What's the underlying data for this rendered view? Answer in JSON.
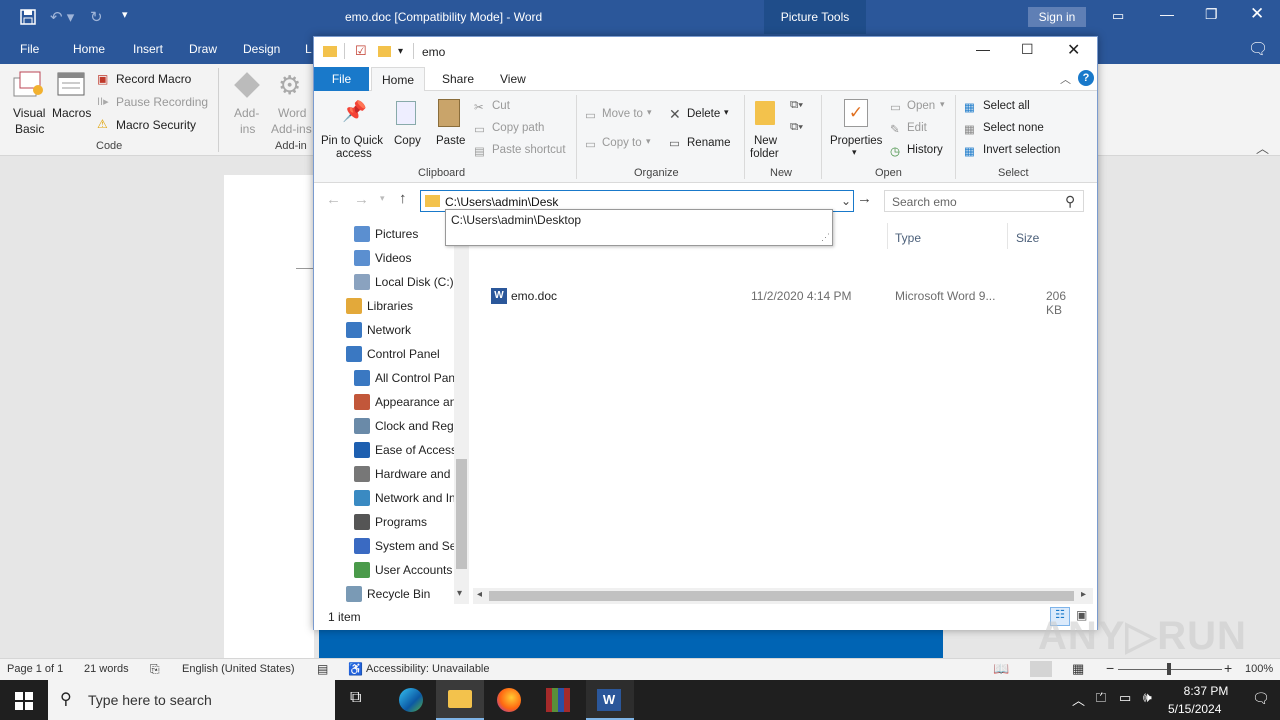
{
  "word": {
    "title": "emo.doc [Compatibility Mode]  -  Word",
    "picture_tools": "Picture Tools",
    "sign_in": "Sign in",
    "tabs": [
      "File",
      "Home",
      "Insert",
      "Draw",
      "Design",
      "L"
    ],
    "ribbon": {
      "visual_basic_1": "Visual",
      "visual_basic_2": "Basic",
      "macros": "Macros",
      "record_macro": "Record Macro",
      "pause_recording": "Pause Recording",
      "macro_security": "Macro Security",
      "code_group": "Code",
      "addins_1": "Add-",
      "addins_2": "ins",
      "word_addins_1": "Word",
      "word_addins_2": "Add-ins",
      "addins_group": "Add-in"
    },
    "status": {
      "page": "Page 1 of 1",
      "words": "21 words",
      "language": "English (United States)",
      "accessibility": "Accessibility: Unavailable",
      "zoom": "100%"
    }
  },
  "explorer": {
    "title": "emo",
    "tabs": [
      "File",
      "Home",
      "Share",
      "View"
    ],
    "clipboard": {
      "pin_1": "Pin to Quick",
      "pin_2": "access",
      "copy": "Copy",
      "paste": "Paste",
      "cut": "Cut",
      "copy_path": "Copy path",
      "paste_shortcut": "Paste shortcut",
      "label": "Clipboard"
    },
    "organize": {
      "move_to": "Move to",
      "copy_to": "Copy to",
      "delete": "Delete",
      "rename": "Rename",
      "label": "Organize"
    },
    "new": {
      "new_folder_1": "New",
      "new_folder_2": "folder",
      "label": "New"
    },
    "open": {
      "properties": "Properties",
      "open": "Open",
      "edit": "Edit",
      "history": "History",
      "label": "Open"
    },
    "select": {
      "select_all": "Select all",
      "select_none": "Select none",
      "invert": "Invert selection",
      "label": "Select"
    },
    "address": {
      "value": "C:\\Users\\admin\\Desk",
      "suggestion": "C:\\Users\\admin\\Desktop",
      "search_placeholder": "Search emo"
    },
    "nav": [
      {
        "label": "Pictures",
        "icon": "pictures-icon",
        "indent": 1
      },
      {
        "label": "Videos",
        "icon": "videos-icon",
        "indent": 1
      },
      {
        "label": "Local Disk (C:)",
        "icon": "disk-icon",
        "indent": 1
      },
      {
        "label": "Libraries",
        "icon": "libraries-icon",
        "indent": 0
      },
      {
        "label": "Network",
        "icon": "network-icon",
        "indent": 0
      },
      {
        "label": "Control Panel",
        "icon": "control-panel-icon",
        "indent": 0
      },
      {
        "label": "All Control Panel Items",
        "icon": "control-panel-icon",
        "indent": 1
      },
      {
        "label": "Appearance and Personalization",
        "icon": "appearance-icon",
        "indent": 1
      },
      {
        "label": "Clock and Region",
        "icon": "clock-icon",
        "indent": 1
      },
      {
        "label": "Ease of Access",
        "icon": "ease-of-access-icon",
        "indent": 1
      },
      {
        "label": "Hardware and Sound",
        "icon": "hardware-icon",
        "indent": 1
      },
      {
        "label": "Network and Internet",
        "icon": "network-internet-icon",
        "indent": 1
      },
      {
        "label": "Programs",
        "icon": "programs-icon",
        "indent": 1
      },
      {
        "label": "System and Security",
        "icon": "system-security-icon",
        "indent": 1
      },
      {
        "label": "User Accounts",
        "icon": "user-accounts-icon",
        "indent": 1
      },
      {
        "label": "Recycle Bin",
        "icon": "recycle-bin-icon",
        "indent": 0
      }
    ],
    "columns": {
      "type": "Type",
      "size": "Size"
    },
    "files": [
      {
        "name": "emo.doc",
        "date": "11/2/2020 4:14 PM",
        "type": "Microsoft Word 9...",
        "size": "206 KB"
      }
    ],
    "status": "1 item"
  },
  "taskbar": {
    "search_placeholder": "Type here to search",
    "time": "8:37 PM",
    "date": "5/15/2024"
  },
  "watermark": "ANY.RUN"
}
